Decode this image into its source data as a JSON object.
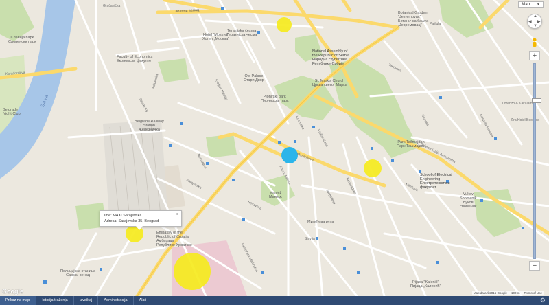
{
  "map": {
    "type_control": {
      "label": "Map"
    },
    "info_window": {
      "line1": "Ime: MAXI Sarajevska",
      "line2": "Adresa: Sarajevska 35, Beograd",
      "close": "×"
    },
    "markers": [
      {
        "kind": "selected",
        "color": "#2bb5ea"
      },
      {
        "kind": "store",
        "color": "#f5ea1e"
      },
      {
        "kind": "store",
        "color": "#f5ea1e"
      },
      {
        "kind": "store",
        "color": "#f5ea1e"
      },
      {
        "kind": "store",
        "color": "#f5ea1e"
      }
    ],
    "labels": {
      "zelenih_beretki": "Зелени венац",
      "gracanicka": "Gračanička",
      "terazije": "Terazijska česma\nТеразијска чесма",
      "hotel_moskva": "Hotel \"Moskva\"\nХотел „Москва\"",
      "skupstina": "National Assembly of\nthe Republic of Serbia\nНародна скупштина\nРепублике Србије",
      "old_palace": "Old Palace\nСтари Двор",
      "st_marks": "St. Mark's Church\nЦрква светог Марка",
      "pionirski": "Pionirski park\nПионирски парк",
      "faculty_econ": "Faculty of Economics\nЕкономски факултет",
      "slomljeni": "Славија парк\nСловенски парк",
      "belgrade_rs": "Belgrade Railway\nStation\nЖелезничка",
      "belgrade_bar": "Belgrade\nNight Club",
      "sava": "Sava",
      "karadjordjeva": "Karađorđeva",
      "savski_trg": "Savski trg",
      "nemanjina": "Nemanjina",
      "kraljice_natalije": "Kraljice Natalije",
      "balkanska": "Balkanska",
      "kneza_milosa": "Kneza Miloša",
      "masarikova": "Masarikova",
      "resavska": "Resavska",
      "takovska": "Takovska",
      "kosovska": "Kosovska",
      "vlajkoviceva": "Vlajkovićeva",
      "bulevar": "Bulevar kralja Aleksandra",
      "beogradska": "Beogradska",
      "krunska": "Krunska",
      "njegoseva": "Njegoševa",
      "mileseva": "Mileševa",
      "sarajevska": "Sarajevska",
      "svetozara": "Svetozara Markovića",
      "nemanjina2": "Nemanjina",
      "embassy": "Embassy of the\nRepublic of Croatia\nАмбасада\nРепублике Хрватске",
      "manjez": "Manjež\nМањеж",
      "tasmajdan": "Park Tašmajdan\nПарк Ташмајдан",
      "electrical": "School of Electrical\nEngineering\nЕлектротехнички\nфакултет",
      "vukov": "Vukov\nSpomenik\nВуков\nспоменик",
      "miticeva": "Митићева рупа",
      "slavija": "Slavija",
      "botanical": "Botanical Garden\n\"Jevremovac\"\nБотаничка башта\n„Јевремовац\"",
      "palilula": "Palilula",
      "zeleni_venac": "Zelenih beretki",
      "lorenzo": "Lorenzo & Kakalamba",
      "zira": "Zira Hotel Beograd",
      "kalemegdan": "Pijaca \"Kalenić\"\nПијаца „Каленић\"",
      "policijska": "Полицијска станица\nСавски венац",
      "despot": "Despota Stefana"
    },
    "credit": {
      "data": "Map data ©2015 Google",
      "scale": "100 m",
      "terms": "Terms of Use"
    },
    "logo": "Google"
  },
  "bottom_nav": {
    "tabs": [
      "Prikaz na mapi",
      "Istorija traženja",
      "Izveštaj",
      "Administracija",
      "Alati"
    ],
    "settings_icon": "gear-icon"
  }
}
